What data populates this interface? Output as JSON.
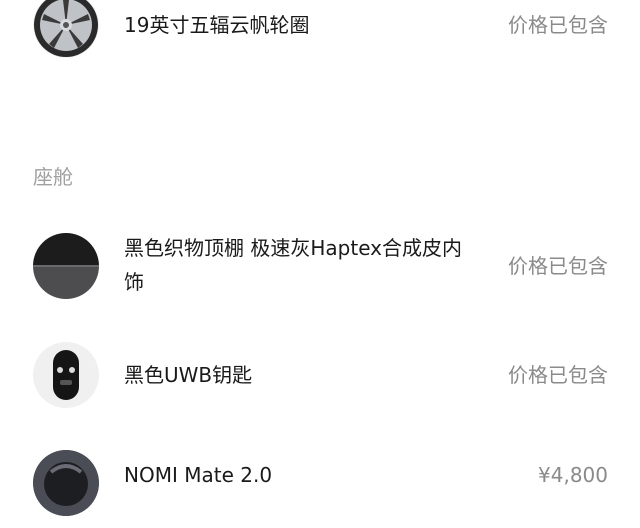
{
  "exterior": {
    "items": [
      {
        "name": "19英寸五辐云帆轮圈",
        "price": "价格已包含",
        "icon": "wheel-icon"
      }
    ]
  },
  "cabin": {
    "section_title": "座舱",
    "items": [
      {
        "name": "黑色织物顶棚 极速灰Haptex合成皮内饰",
        "price": "价格已包含",
        "icon": "interior-swatch-icon"
      },
      {
        "name": "黑色UWB钥匙",
        "price": "价格已包含",
        "icon": "key-fob-icon"
      },
      {
        "name": "NOMI Mate 2.0",
        "price": "¥4,800",
        "icon": "nomi-mate-icon"
      }
    ]
  }
}
